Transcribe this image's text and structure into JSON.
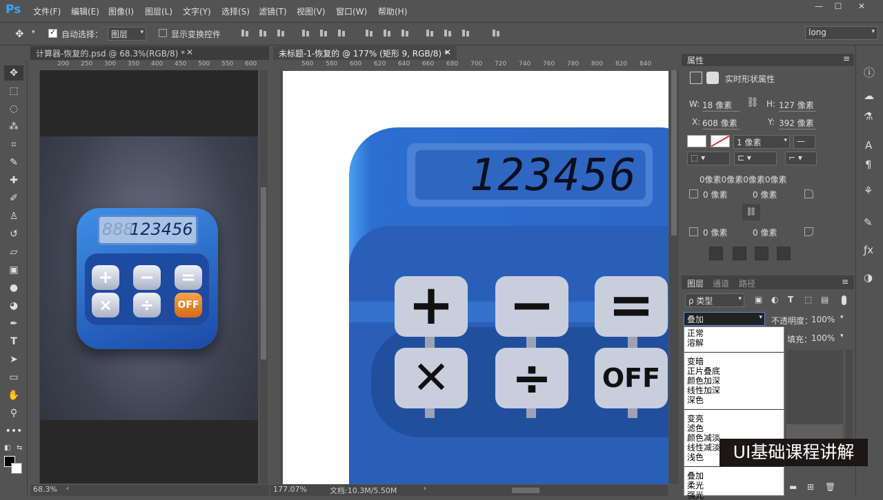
{
  "app": {
    "logo": "Ps"
  },
  "menu": [
    "文件(F)",
    "编辑(E)",
    "图像(I)",
    "图层(L)",
    "文字(Y)",
    "选择(S)",
    "滤镜(T)",
    "视图(V)",
    "窗口(W)",
    "帮助(H)"
  ],
  "options": {
    "auto_select_label": "自动选择：",
    "auto_select_value": "图层",
    "show_transform_label": "显示变换控件",
    "workspace": "long"
  },
  "tabs": {
    "doc1": "计算器-恢复的.psd @ 68.3%(RGB/8) *",
    "doc2": "未标题-1-恢复的 @ 177% (矩形 9, RGB/8) *"
  },
  "ruler1": [
    "200",
    "250",
    "300",
    "350",
    "400",
    "450",
    "500",
    "550",
    "600"
  ],
  "ruler2": [
    "560",
    "580",
    "600",
    "620",
    "640",
    "660",
    "680",
    "700",
    "720",
    "740",
    "760",
    "780",
    "800",
    "820",
    "840"
  ],
  "calc": {
    "display": "123456",
    "display_ghost": "888",
    "off_label": "OFF"
  },
  "properties": {
    "title": "属性",
    "subtitle": "实时形状属性",
    "w": "18 像素",
    "h": "127 像素",
    "x": "608 像素",
    "y": "392 像素",
    "stroke": "1 像素",
    "radii": "0像素0像素0像素0像素",
    "r1": "0 像素",
    "r2": "0 像素",
    "r3": "0 像素",
    "r4": "0 像素",
    "w_label": "W:",
    "h_label": "H:",
    "x_label": "X:",
    "y_label": "Y:"
  },
  "layers": {
    "tabs": [
      "图层",
      "通道",
      "路径"
    ],
    "filter": "ρ 类型",
    "blend": "叠加",
    "opacity_label": "不透明度：",
    "opacity": "100%",
    "fill_label": "填充：",
    "fill": "100%"
  },
  "blend_groups": [
    [
      "正常",
      "溶解"
    ],
    [
      "变暗",
      "正片叠底",
      "颜色加深",
      "线性加深",
      "深色"
    ],
    [
      "变亮",
      "滤色",
      "颜色减淡",
      "线性减淡",
      "浅色"
    ],
    [
      "叠加",
      "柔光",
      "强光"
    ]
  ],
  "caption": "UI基础课程讲解",
  "status": {
    "zoom1": "68.3%",
    "zoom2": "177.07%",
    "docinfo": "文档:10.3M/5.50M"
  },
  "colors": {
    "ps_blue": "#31a8ff",
    "calc_blue": "#2d64c0",
    "key": "#c9cedd",
    "off": "#e87a1e"
  }
}
